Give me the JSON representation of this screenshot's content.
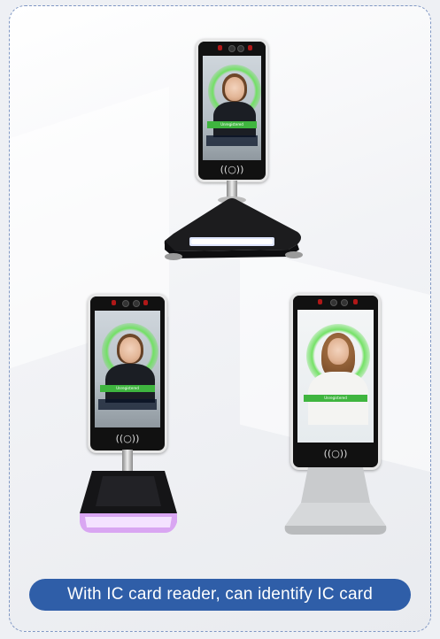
{
  "caption": "With IC card reader, can identify IC card",
  "devices": [
    {
      "name": "triangle-base-terminal",
      "banner": "Unregistered",
      "nfc": "((○))"
    },
    {
      "name": "square-stand-terminal",
      "banner": "Unregistered",
      "nfc": "((○))"
    },
    {
      "name": "desktop-stand-terminal",
      "banner": "Unregistered",
      "nfc": "((○))"
    }
  ],
  "colors": {
    "caption_bg": "#2f5ea8",
    "recognition_green": "#6ee15f",
    "frame_border": "#7f97c4"
  }
}
